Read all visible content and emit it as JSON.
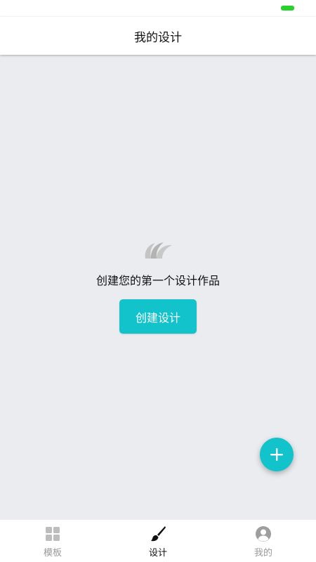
{
  "header": {
    "title": "我的设计"
  },
  "empty_state": {
    "icon": "brush-strokes-icon",
    "message": "创建您的第一个设计作品",
    "button_label": "创建设计"
  },
  "fab": {
    "icon": "plus-icon"
  },
  "tabs": [
    {
      "label": "模板",
      "icon": "grid-icon",
      "active": false
    },
    {
      "label": "设计",
      "icon": "paintbrush-icon",
      "active": true
    },
    {
      "label": "我的",
      "icon": "user-icon",
      "active": false
    }
  ],
  "colors": {
    "accent": "#12c3cc",
    "background": "#ebecf0",
    "battery": "#2bd12b"
  }
}
